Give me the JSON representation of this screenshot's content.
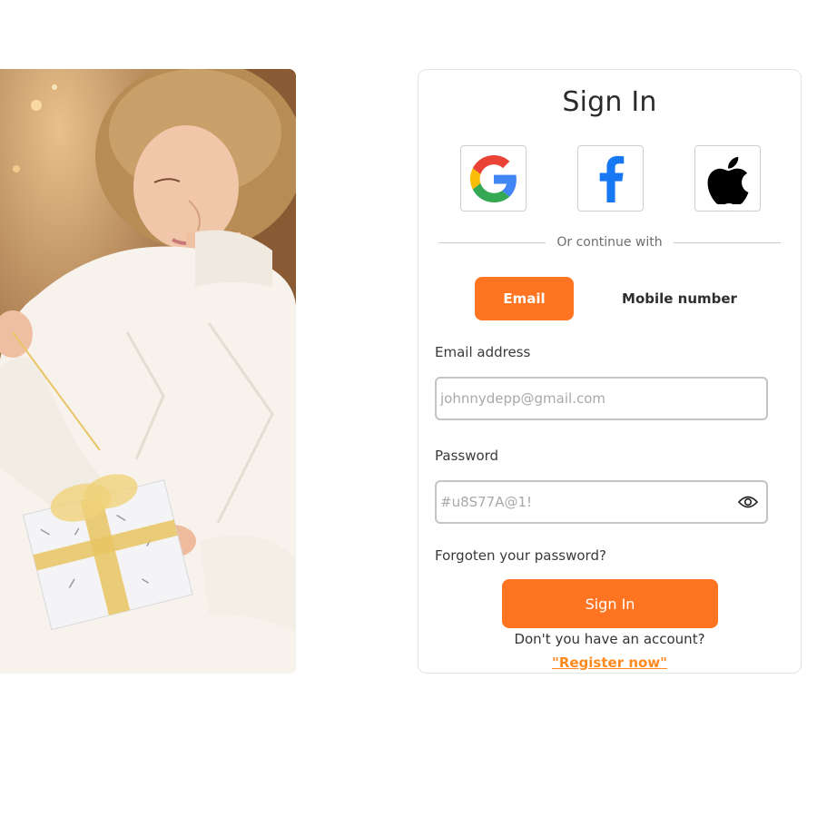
{
  "signin": {
    "title": "Sign In",
    "social": [
      {
        "name": "google",
        "icon": "google-icon"
      },
      {
        "name": "facebook",
        "icon": "facebook-icon"
      },
      {
        "name": "apple",
        "icon": "apple-icon"
      }
    ],
    "divider_text": "Or continue with",
    "tabs": {
      "email": "Email",
      "mobile": "Mobile number",
      "active": "email"
    },
    "email_label": "Email address",
    "email_placeholder": "johnnydepp@gmail.com",
    "password_label": "Password",
    "password_placeholder": "#u8S77A@1!",
    "eye_icon": "eye-icon",
    "forgot_text": "Forgoten your password?",
    "submit_label": "Sign In",
    "no_account_text": "Don't you have an account?",
    "register_text": "\"Register now\""
  },
  "colors": {
    "accent": "#ff7420",
    "link": "#ff8a1f",
    "border": "#c4c4c4",
    "facebook_blue": "#1877f2"
  }
}
